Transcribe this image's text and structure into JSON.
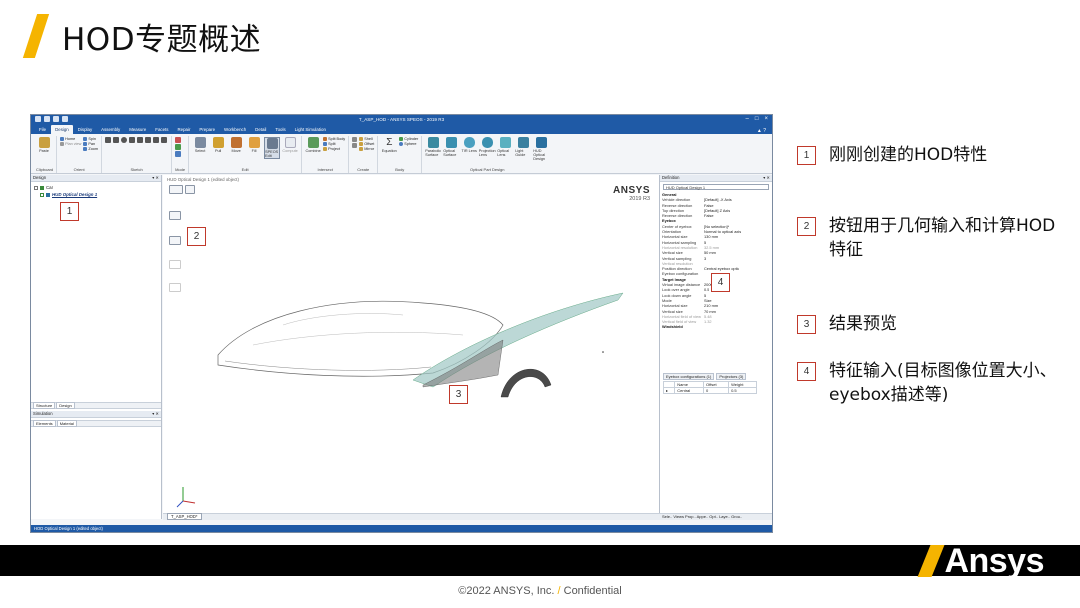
{
  "slide": {
    "title": "HOD专题概述",
    "legend": [
      {
        "num": "1",
        "text": "刚刚创建的HOD特性"
      },
      {
        "num": "2",
        "text": "按钮用于几何输入和计算HOD特征"
      },
      {
        "num": "3",
        "text": "结果预览"
      },
      {
        "num": "4",
        "text": "特征输入(目标图像位置大小、eyebox描述等)"
      }
    ],
    "footer_brand": "Ansys",
    "copyright_left": "©2022 ANSYS, Inc.",
    "copyright_sep": "/",
    "copyright_right": "Confidential",
    "colors": {
      "accent": "#f5b400",
      "callout_border": "#c0392b",
      "app_blue": "#1f5aa6"
    }
  },
  "app": {
    "window_title": "T_ASP_HOD - ANSYS SPEOS - 2019 R3",
    "menu_tabs": [
      "File",
      "Design",
      "Display",
      "Assembly",
      "Measure",
      "Facets",
      "Repair",
      "Prepare",
      "Workbench",
      "Detail",
      "Tools",
      "Light Simulation"
    ],
    "active_tab": "Design",
    "ribbon_groups": [
      {
        "label": "Clipboard",
        "items": [
          "Paste"
        ]
      },
      {
        "label": "Orient",
        "items": [
          "Home",
          "Plan view",
          "Spin",
          "Pan",
          "Zoom"
        ]
      },
      {
        "label": "Sketch",
        "items": []
      },
      {
        "label": "Mode",
        "items": []
      },
      {
        "label": "Edit",
        "items": [
          "Select",
          "Pull",
          "Move",
          "Fill",
          "SPEOS Edit",
          "Compute"
        ]
      },
      {
        "label": "Intersect",
        "items": [
          "Combine",
          "Split Body",
          "Split",
          "Project"
        ]
      },
      {
        "label": "Create",
        "items": [
          "Shell",
          "Offset",
          "Mirror"
        ]
      },
      {
        "label": "Body",
        "items": [
          "Equation",
          "Cylinder",
          "Sphere"
        ]
      },
      {
        "label": "Optical Part Design",
        "items": [
          "Parabolic Surface",
          "Optical Surface",
          "TIR Lens",
          "Projection Lens",
          "Optical Lens",
          "Light Guide",
          "HUD Optical Design"
        ]
      }
    ],
    "left_panel": {
      "header": "Design",
      "tree_root": "Car",
      "hod_item": "HUD Optical Design 1",
      "bottom_tabs": [
        "Structure",
        "Design"
      ],
      "simulation_header": "Simulation",
      "simulation_tabs": [
        "Elements",
        "Material"
      ]
    },
    "viewport": {
      "title": "HUD Optical Design 1 (edited object)",
      "logo_main": "ANSYS",
      "logo_sub": "2019 R3",
      "doc_tab": "T_ASP_HOD*"
    },
    "right_panel": {
      "header": "Definition",
      "selected": "HUD Optical Design 1",
      "properties": [
        {
          "type": "sec",
          "k": "General"
        },
        {
          "k": "Vehicle direction",
          "v": "[Default] -X Axis"
        },
        {
          "k": "Reverse direction",
          "v": "False"
        },
        {
          "k": "Top direction",
          "v": "[Default] Z Axis"
        },
        {
          "k": "Reverse direction",
          "v": "False"
        },
        {
          "type": "sec",
          "k": "Eyebox"
        },
        {
          "k": "Center of eyebox",
          "v": "[No selection]*"
        },
        {
          "k": "Orientation",
          "v": "Normal to optical axis"
        },
        {
          "k": "Horizontal size",
          "v": "130 mm"
        },
        {
          "k": "Horizontal sampling",
          "v": "5"
        },
        {
          "k": "Horizontal resolution",
          "v": "32.5 mm",
          "dim": true
        },
        {
          "k": "Vertical size",
          "v": "50 mm"
        },
        {
          "k": "Vertical sampling",
          "v": "3"
        },
        {
          "k": "Vertical resolution",
          "v": "",
          "dim": true
        },
        {
          "k": "Position direction",
          "v": "Central eyebox optic"
        },
        {
          "k": "Eyebox configuration",
          "v": ""
        },
        {
          "type": "sec",
          "k": "Target Image"
        },
        {
          "k": "Virtual image distance",
          "v": "2000 mm"
        },
        {
          "k": "Look over angle",
          "v": "0.5"
        },
        {
          "k": "Look down angle",
          "v": "5"
        },
        {
          "k": "Mode",
          "v": "Size"
        },
        {
          "k": "Horizontal size",
          "v": "210 mm"
        },
        {
          "k": "Vertical size",
          "v": "70 mm"
        },
        {
          "k": "Horizontal field of view",
          "v": "5.48",
          "dim": true
        },
        {
          "k": "Vertical field of view",
          "v": "1.32",
          "dim": true
        },
        {
          "type": "sec",
          "k": "Windshield"
        }
      ],
      "config_tabs": [
        "Eyebox configurations (1)",
        "Projectors (3)"
      ],
      "config_headers": [
        "Name",
        "Offset",
        "Weight"
      ],
      "config_rows": [
        [
          "Central",
          "0",
          "0.5"
        ]
      ],
      "bottom_tabs": "Sele.. Views Prop.. Appe.. Opt.. Laye.. Grou.."
    },
    "status_text": "HOD Optical Design 1 (edited object)"
  },
  "callouts": {
    "c1": "1",
    "c2": "2",
    "c3": "3",
    "c4": "4"
  }
}
